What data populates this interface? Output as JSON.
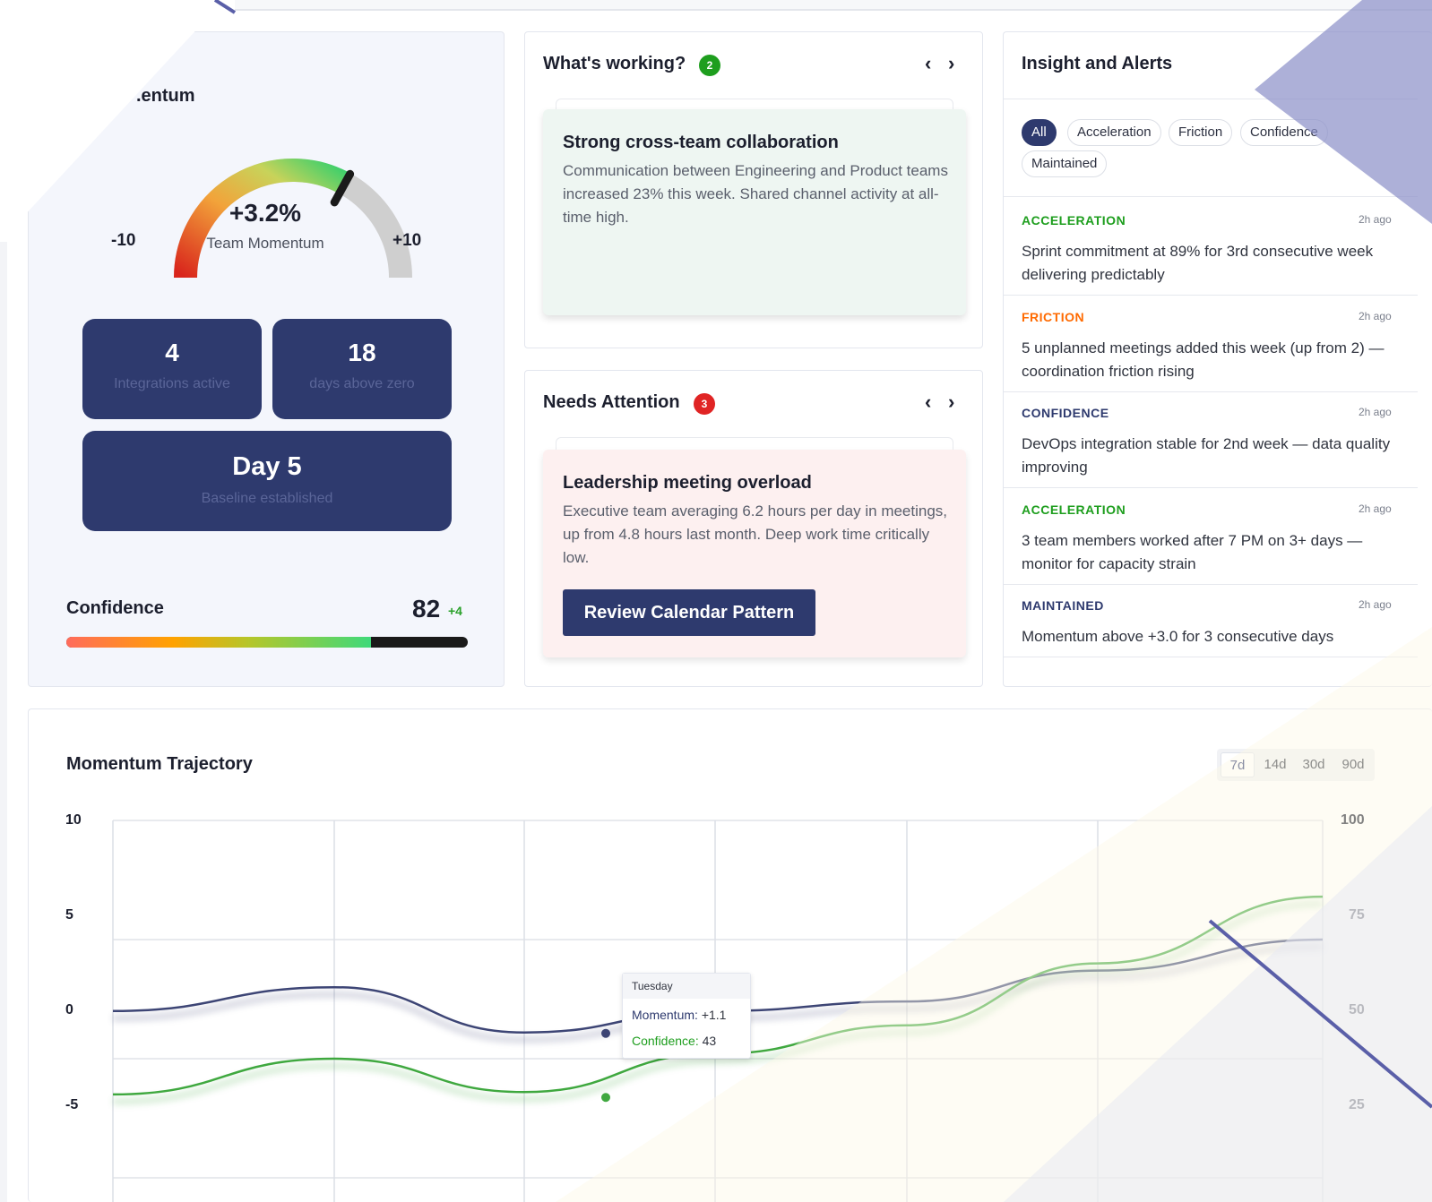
{
  "momentum": {
    "title": ".entum",
    "gauge_value": "+3.2%",
    "gauge_label": "Team Momentum",
    "gauge_min": "-10",
    "gauge_max": "+10",
    "gauge_reading": 3.2,
    "tiles": [
      {
        "number": "4",
        "label": "Integrations active"
      },
      {
        "number": "18",
        "label": "days above zero"
      },
      {
        "number": "Day 5",
        "label": "Baseline established"
      }
    ],
    "confidence_label": "Confidence",
    "confidence_value": "82",
    "confidence_delta": "+4",
    "confidence_fraction": 0.76
  },
  "whats_working": {
    "title": "What's working?",
    "count": "2",
    "prev_icon": "chevron-left-icon",
    "next_icon": "chevron-right-icon",
    "card": {
      "title": "Strong cross-team collaboration",
      "body": "Communication between Engineering and Product teams increased 23% this week. Shared channel activity at all-time high."
    }
  },
  "needs_attention": {
    "title": "Needs Attention",
    "count": "3",
    "card": {
      "title": "Leadership meeting overload",
      "body": "Executive team averaging 6.2 hours per day in meetings, up from 4.8 hours last month. Deep work time critically low.",
      "cta": "Review Calendar Pattern"
    }
  },
  "insights": {
    "title": "Insight and Alerts",
    "filters": [
      "All",
      "Acceleration",
      "Friction",
      "Confidence",
      "Maintained"
    ],
    "active_filter": "All",
    "alerts": [
      {
        "category": "ACCELERATION",
        "color": "#1e9e1e",
        "time": "2h ago",
        "text": "Sprint commitment at 89% for 3rd consecutive week delivering predictably"
      },
      {
        "category": "FRICTION",
        "color": "#ff6a00",
        "time": "2h ago",
        "text": "5 unplanned meetings added this week (up from 2) — coordination friction rising"
      },
      {
        "category": "CONFIDENCE",
        "color": "#2e3a6e",
        "time": "2h ago",
        "text": "DevOps integration stable for 2nd week — data quality improving"
      },
      {
        "category": "ACCELERATION",
        "color": "#1e9e1e",
        "time": "2h ago",
        "text": "3 team members worked after 7 PM on 3+ days — monitor for capacity strain"
      },
      {
        "category": "MAINTAINED",
        "color": "#2e3a6e",
        "time": "2h ago",
        "text": "Momentum above +3.0 for 3 consecutive days"
      }
    ]
  },
  "trajectory": {
    "title": "Momentum Trajectory",
    "ranges": [
      "7d",
      "14d",
      "30d",
      "90d"
    ],
    "active_range": "7d",
    "tooltip": {
      "day": "Tuesday",
      "momentum_label": "Momentum:",
      "momentum_value": "+1.1",
      "confidence_label": "Confidence:",
      "confidence_value": "43"
    }
  },
  "colors": {
    "navy": "#2e3a6e",
    "green": "#2aa12a",
    "momentum_line": "#3d4575",
    "confidence_line": "#3fa83f"
  },
  "chart_data": {
    "type": "line",
    "x": [
      0,
      1,
      2,
      3,
      4,
      5,
      6
    ],
    "series": [
      {
        "name": "Momentum",
        "axis": "left",
        "values": [
          2.0,
          3.0,
          1.1,
          2.0,
          2.4,
          3.7,
          5.0
        ]
      },
      {
        "name": "Confidence",
        "axis": "right",
        "values": [
          42.5,
          50,
          43,
          51,
          57,
          70,
          84
        ]
      }
    ],
    "y_left_ticks": [
      "10",
      "5",
      "0",
      "-5"
    ],
    "y_right_ticks": [
      "100",
      "75",
      "50",
      "25"
    ],
    "y_left_range": [
      -10,
      10
    ],
    "y_right_range": [
      0,
      100
    ],
    "grid": true
  }
}
